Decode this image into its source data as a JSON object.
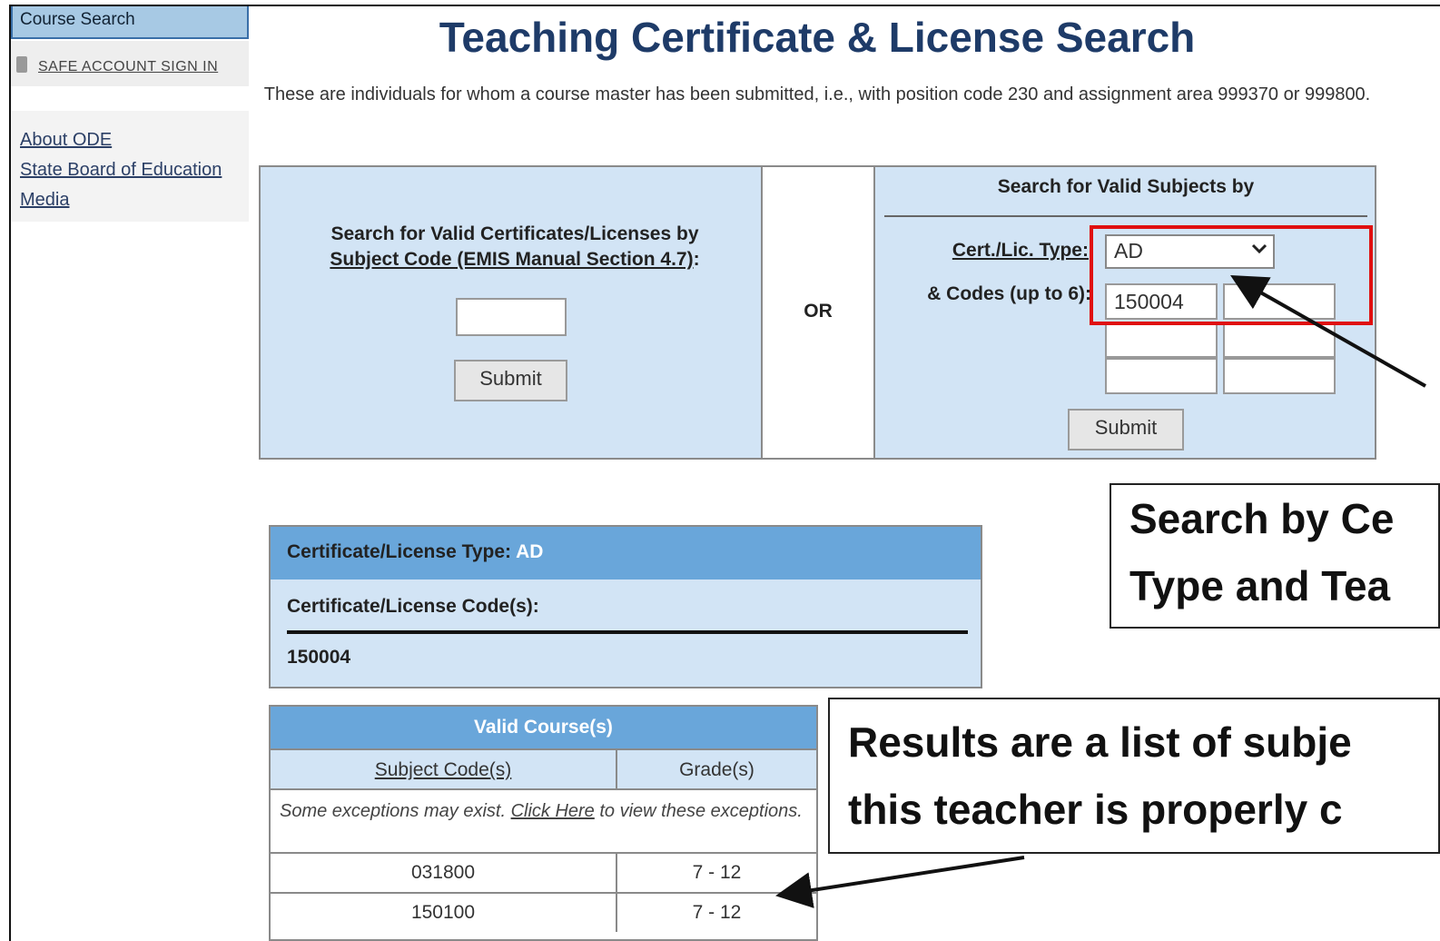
{
  "sidebar": {
    "course_search": "Course Search",
    "safe_account": "SAFE ACCOUNT SIGN IN",
    "links": [
      "About ODE",
      "State Board of Education",
      "Media"
    ]
  },
  "header": {
    "title": "Teaching Certificate & License Search",
    "intro": "These are individuals for whom a course master has been submitted, i.e., with position code 230 and assignment area 999370 or 999800."
  },
  "search": {
    "left": {
      "heading_line1": "Search for Valid Certificates/Licenses by",
      "heading_link": "Subject Code (EMIS Manual Section 4.7)",
      "heading_suffix": ":",
      "submit": "Submit"
    },
    "or_label": "OR",
    "right": {
      "heading": "Search for Valid Subjects by",
      "cert_label": "Cert./Lic. Type",
      "cert_colon": ":",
      "cert_value": "AD",
      "codes_label": "& Codes (up to 6):",
      "code_values": [
        "150004",
        "",
        "",
        "",
        "",
        ""
      ],
      "submit": "Submit"
    }
  },
  "results": {
    "type_label": "Certificate/License Type: ",
    "type_value": "AD",
    "codes_label": "Certificate/License Code(s):",
    "code_value": "150004",
    "courses": {
      "header": "Valid Course(s)",
      "col_code": "Subject Code(s)",
      "col_grade": "Grade(s)",
      "exceptions_pre": "Some exceptions may exist. ",
      "exceptions_link": "Click Here",
      "exceptions_post": " to view these exceptions.",
      "rows": [
        {
          "code": "031800",
          "grade": "7 - 12"
        },
        {
          "code": "150100",
          "grade": "7 - 12"
        }
      ]
    }
  },
  "callouts": {
    "cert_line1": "Search by Ce",
    "cert_line2": "Type and Tea",
    "results_line1": "Results are a list of subje",
    "results_line2": "this teacher is properly c"
  },
  "colors": {
    "accent_blue": "#69a6da",
    "panel_blue": "#d2e4f5",
    "title_navy": "#1e3b68",
    "highlight_red": "#e01010"
  }
}
